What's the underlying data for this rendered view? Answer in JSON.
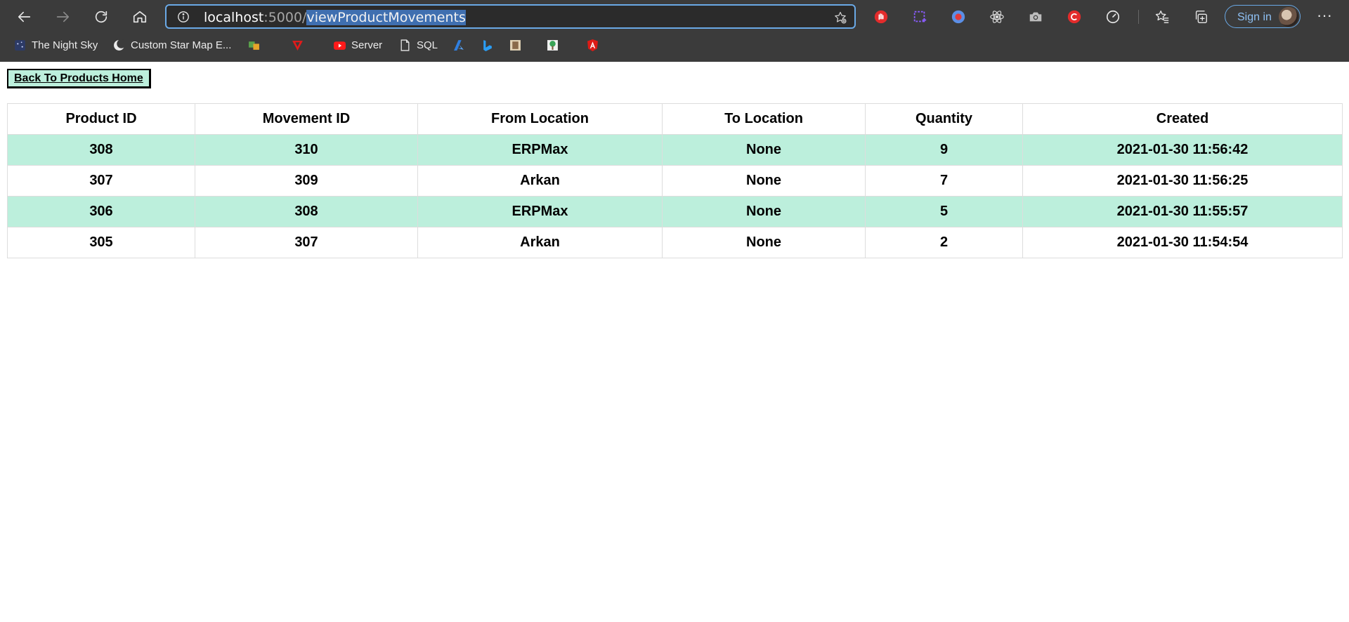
{
  "browser": {
    "url": {
      "host": "localhost",
      "port": ":5000/",
      "path": "viewProductMovements"
    },
    "sign_in_label": "Sign in",
    "more_label": "···",
    "bookmarks": [
      {
        "label": "The Night Sky",
        "icon": "night-sky-icon"
      },
      {
        "label": "Custom Star Map E...",
        "icon": "moon-icon"
      },
      {
        "label": "",
        "icon": "translate-icon"
      },
      {
        "label": "",
        "icon": "red-v-icon"
      },
      {
        "label": "Server",
        "icon": "youtube-icon"
      },
      {
        "label": "SQL",
        "icon": "page-icon"
      },
      {
        "label": "",
        "icon": "azure-icon"
      },
      {
        "label": "",
        "icon": "bing-icon"
      },
      {
        "label": "",
        "icon": "image-icon"
      },
      {
        "label": "",
        "icon": "tree-icon"
      },
      {
        "label": "",
        "icon": "angular-icon"
      }
    ],
    "extensions": [
      "hand-stop-icon",
      "screenshot-crop-icon",
      "record-icon",
      "react-icon",
      "camera-icon",
      "red-c-icon",
      "speedometer-icon",
      "favorites-icon",
      "collections-icon"
    ]
  },
  "page": {
    "back_button_label": "Back To Products Home",
    "table": {
      "headers": [
        "Product ID",
        "Movement ID",
        "From Location",
        "To Location",
        "Quantity",
        "Created"
      ],
      "rows": [
        [
          "308",
          "310",
          "ERPMax",
          "None",
          "9",
          "2021-01-30 11:56:42"
        ],
        [
          "307",
          "309",
          "Arkan",
          "None",
          "7",
          "2021-01-30 11:56:25"
        ],
        [
          "306",
          "308",
          "ERPMax",
          "None",
          "5",
          "2021-01-30 11:55:57"
        ],
        [
          "305",
          "307",
          "Arkan",
          "None",
          "2",
          "2021-01-30 11:54:54"
        ]
      ]
    }
  },
  "colors": {
    "row_highlight": "#bcefdc",
    "chrome_bg": "#3b3b3b",
    "omnibox_border": "#6aa9e6"
  }
}
